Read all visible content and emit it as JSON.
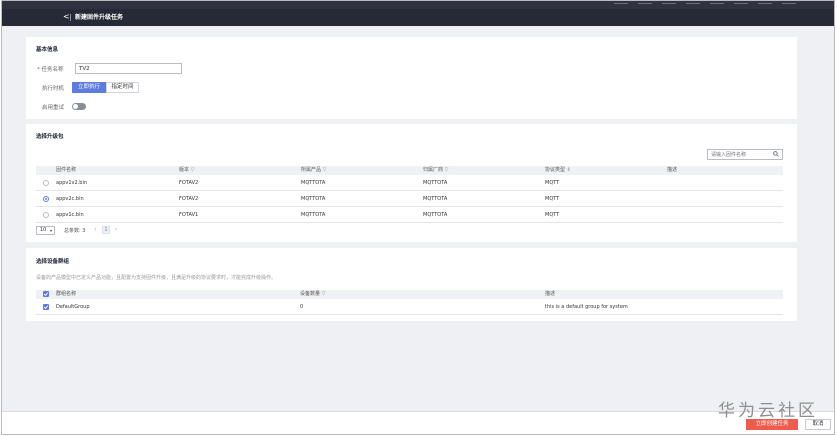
{
  "header": {
    "back_icon": "chevron-left-icon",
    "back_glyph": "<",
    "title": "新建固件升级任务"
  },
  "basic_info": {
    "title": "基本信息",
    "task_name_label": "任务名称",
    "required_mark": "*",
    "task_name_value": "TV2",
    "exec_time_label": "执行时机",
    "exec_now_label": "立即执行",
    "exec_specified_label": "指定时间",
    "retry_label": "启用重试",
    "retry_enabled": false
  },
  "packages": {
    "title": "选择升级包",
    "search_placeholder": "请输入固件名称",
    "columns": [
      "固件名称",
      "版本",
      "所属产品",
      "归属厂商",
      "协议类型",
      "描述"
    ],
    "filter_icon": "filter-icon",
    "filter_glyph": "▽",
    "sort_glyph": "⇕",
    "rows": [
      {
        "name": "appv1v2.bin",
        "version": "FOTAV2",
        "product": "MQTTOTA",
        "vendor": "MQTTOTA",
        "protocol": "MQTT",
        "desc": "",
        "selected": false
      },
      {
        "name": "appv2c.bin",
        "version": "FOTAV2",
        "product": "MQTTOTA",
        "vendor": "MQTTOTA",
        "protocol": "MQTT",
        "desc": "",
        "selected": true
      },
      {
        "name": "appv1c.bin",
        "version": "FOTAV1",
        "product": "MQTTOTA",
        "vendor": "MQTTOTA",
        "protocol": "MQTT",
        "desc": "",
        "selected": false
      }
    ],
    "pager": {
      "page_size": "10",
      "size_caret": "▾",
      "total_label": "总条数: 3",
      "prev": "‹",
      "current_page": "1",
      "next": "›"
    }
  },
  "device_groups": {
    "title": "选择设备群组",
    "description": "设备的产品模型中已定义产品功能，且配置为支持固件升级，且满足升级的协议要求时，才能完成升级操作。",
    "columns": [
      "群组名称",
      "设备数量",
      "描述"
    ],
    "rows": [
      {
        "name": "DefaultGroup",
        "count": "0",
        "desc": "this is a default group for system",
        "checked": true
      }
    ]
  },
  "footer": {
    "create_label": "立即创建任务",
    "cancel_label": "取消"
  },
  "watermark": "华为云社区",
  "colors": {
    "primary": "#5e7ce0",
    "danger": "#ee5c4e",
    "header_bg": "#262a37",
    "page_bg": "#eff0f4"
  }
}
